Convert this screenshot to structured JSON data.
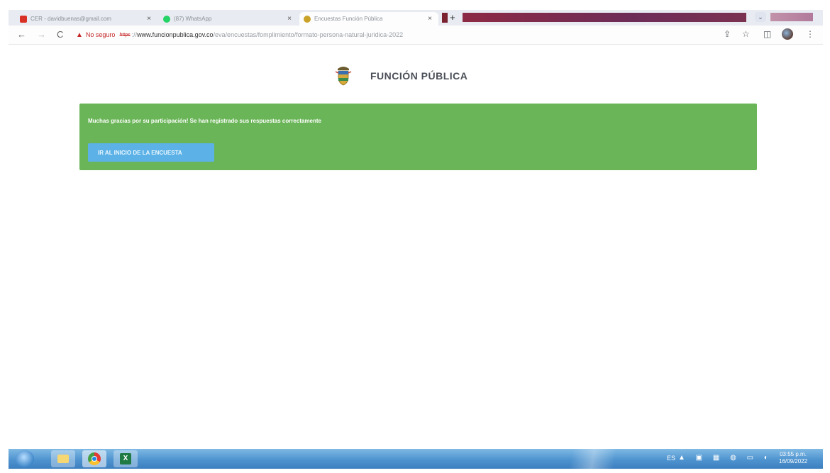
{
  "browser": {
    "tabs": [
      {
        "label": "CER - davidbuenas@gmail.com",
        "close": "×",
        "active": false
      },
      {
        "label": "(87) WhatsApp",
        "close": "×",
        "active": false
      },
      {
        "label": "Encuestas Función Pública",
        "close": "×",
        "active": true
      }
    ],
    "new_tab": "+",
    "tab_menu": "⌄",
    "nav": {
      "back": "←",
      "forward": "→",
      "reload": "C"
    },
    "address": {
      "warning_icon": "▲",
      "security": "No seguro",
      "scheme": "https",
      "host": "www.funcionpublica.gov.co",
      "path": "/eva/encuestas/fomplimiento/formato-persona-natural-juridica-2022"
    },
    "toolbar_icons": {
      "share": "⇪",
      "star": "☆",
      "sidepanel": "◫",
      "menu": "⋮"
    }
  },
  "page": {
    "brand": "FUNCIÓN PÚBLICA",
    "alert": {
      "message": "Muchas gracias por su participación! Se han registrado sus respuestas correctamente",
      "button": "IR AL INICIO DE LA ENCUESTA"
    }
  },
  "taskbar": {
    "language": "ES",
    "tray_icons": "▲ ▣ ▦ ◍ ▭ ◐",
    "time": "03:55 p.m.",
    "date": "16/09/2022"
  }
}
